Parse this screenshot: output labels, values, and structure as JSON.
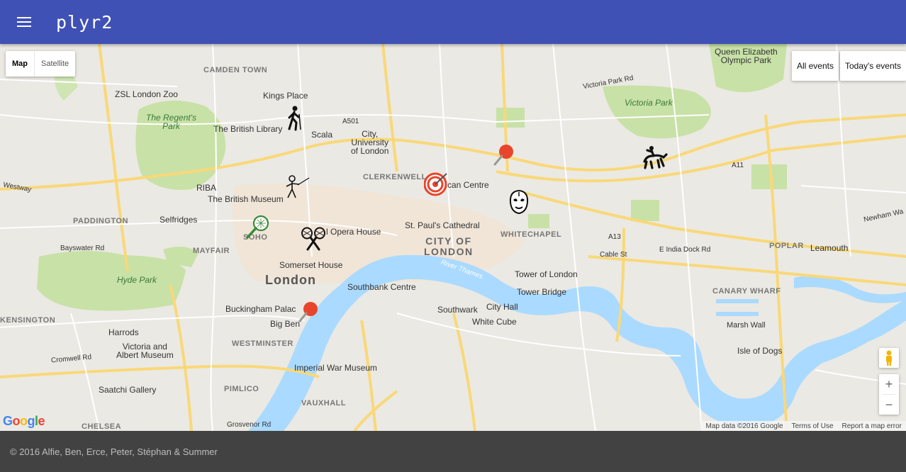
{
  "app": {
    "title": "plyr2"
  },
  "map_controls": {
    "map_type": [
      "Map",
      "Satellite"
    ],
    "filters": [
      "All events",
      "Today's events"
    ],
    "zoom_in": "+",
    "zoom_out": "−",
    "google": "Google",
    "attribution": [
      "Map data ©2016 Google",
      "Terms of Use",
      "Report a map error"
    ]
  },
  "labels": {
    "camden": "CAMDEN TOWN",
    "zoo": "ZSL London Zoo",
    "regents": "The Regent's\nPark",
    "kings": "Kings Place",
    "library": "The British Library",
    "scala": "Scala",
    "city_uni": "City,\nUniversity\nof London",
    "clerkenwell": "CLERKENWELL",
    "barbican": "can Centre",
    "riba": "RIBA",
    "museum": "The British Museum",
    "paddington": "PADDINGTON",
    "selfridges": "Selfridges",
    "soho": "SOHO",
    "opera": "l Opera House",
    "stpauls": "St. Paul's Cathedral",
    "city_of_london": "CITY OF\nLONDON",
    "whitechapel": "WHITECHAPEL",
    "mayfair": "MAYFAIR",
    "somerset": "Somerset House",
    "london": "London",
    "hyde": "Hyde Park",
    "southbank": "Southbank Centre",
    "tower": "Tower of London",
    "towerbridge": "Tower Bridge",
    "buckingham": "Buckingham Palac",
    "bigben": "Big Ben",
    "southwark": "Southwark",
    "cityhall": "City Hall",
    "whitecube": "White Cube",
    "harrods": "Harrods",
    "va": "Victoria and\nAlbert Museum",
    "westminster": "WESTMINSTER",
    "kensington": "KENSINGTON",
    "imperial": "Imperial War Museum",
    "saatchi": "Saatchi Gallery",
    "pimlico": "PIMLICO",
    "vauxhall": "VAUXHALL",
    "chelsea": "CHELSEA",
    "queen_elizabeth": "Queen Elizabeth\nOlympic Park",
    "victoria_park": "Victoria Park",
    "poplar": "POPLAR",
    "leamouth": "Leamouth",
    "canary": "CANARY WHARF",
    "isle_dogs": "Isle of Dogs",
    "marsh_wall": "Marsh Wall",
    "river_thames": "River Thames",
    "westway": "Westway",
    "newham": "Newham Wa",
    "a11": "A11",
    "a13": "A13",
    "a501": "A501",
    "cable": "Cable St",
    "india_dock": "E India Dock Rd",
    "cromwell": "Cromwell Rd",
    "grosvenor": "Grosvenor Rd",
    "bayswater": "Bayswater Rd",
    "victoria_park_rd": "Victoria Park Rd"
  },
  "markers": [
    {
      "icon": "hiking-icon"
    },
    {
      "icon": "fencing-icon"
    },
    {
      "icon": "target-icon"
    },
    {
      "icon": "pin-icon"
    },
    {
      "icon": "wrestling-mask-icon"
    },
    {
      "icon": "rodeo-icon"
    },
    {
      "icon": "tennis-icon"
    },
    {
      "icon": "badminton-icon"
    },
    {
      "icon": "pin-icon"
    }
  ],
  "footer": {
    "text": "© 2016 Alfie, Ben, Erce, Peter, Stéphan & Summer"
  }
}
